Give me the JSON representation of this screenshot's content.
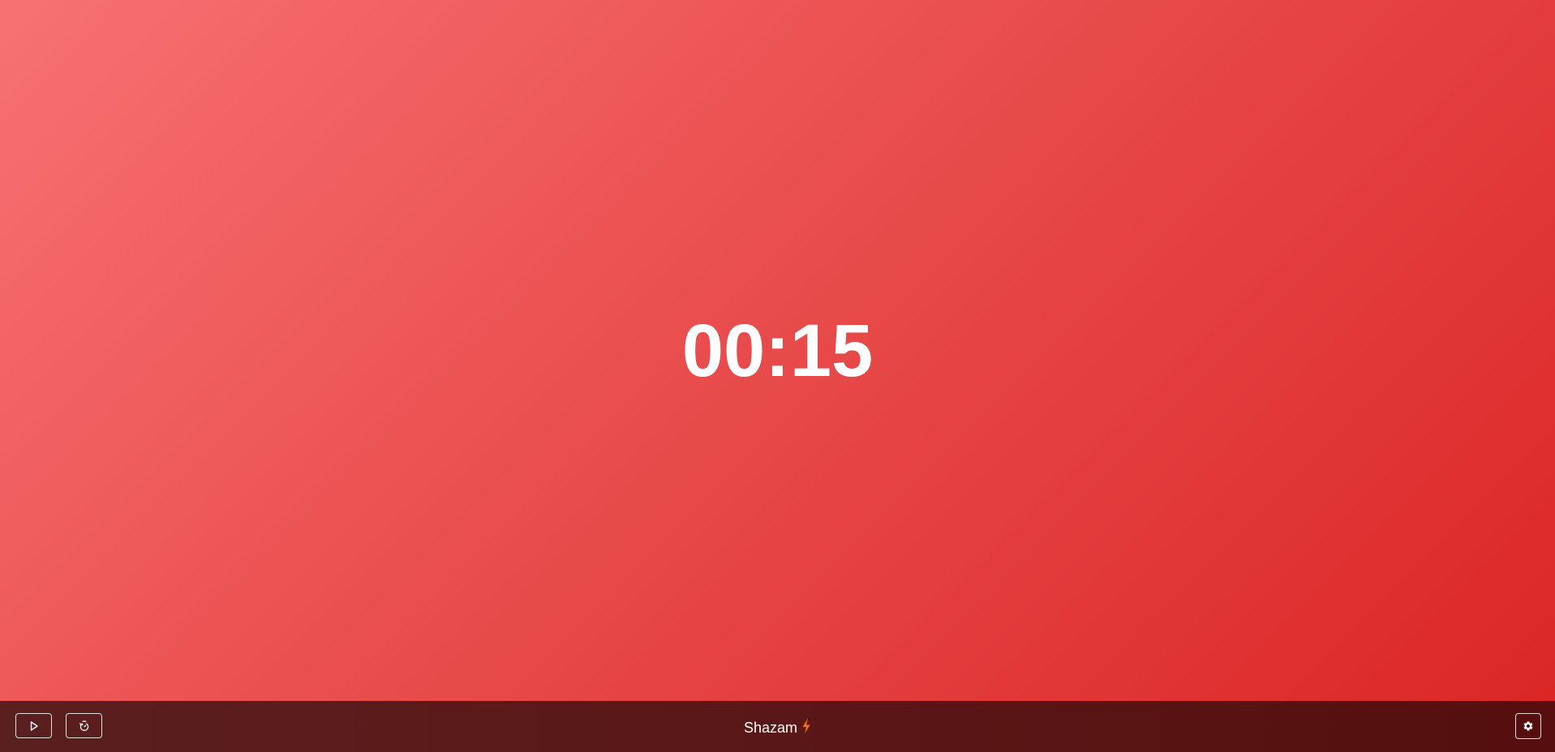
{
  "timer": {
    "display": "00:15"
  },
  "bottom_bar": {
    "brand_name": "Shazam",
    "brand_icon": "lightning-bolt-icon",
    "brand_icon_color": "#f97316",
    "play_button_icon": "play-icon",
    "restart_button_icon": "restart-timer-icon",
    "settings_button_icon": "gear-icon"
  },
  "colors": {
    "background_gradient_start": "#f87171",
    "background_gradient_end": "#dc2626",
    "bar_background": "#5a1717",
    "text": "#ffffff"
  }
}
